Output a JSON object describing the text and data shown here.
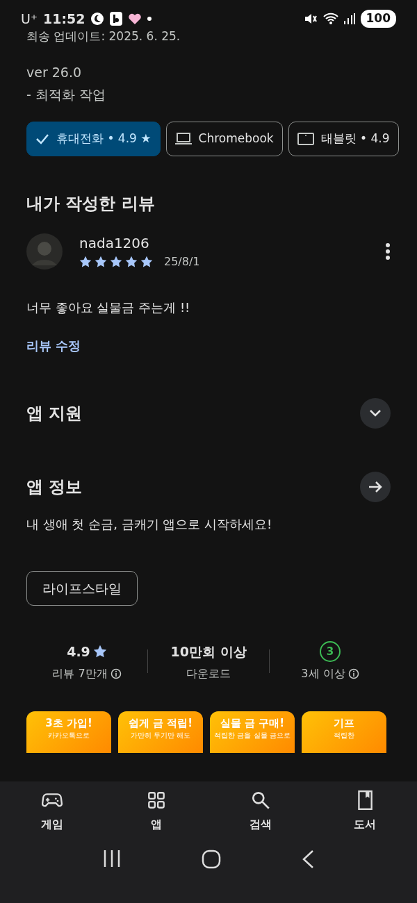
{
  "status_bar": {
    "carrier": "U⁺",
    "time": "11:52",
    "battery": "100"
  },
  "update": {
    "date_line": "최송 업데이트: 2025. 6. 25.",
    "version": "ver 26.0",
    "note": "- 최적화 작업"
  },
  "device_chips": [
    {
      "label": "휴대전화 • 4.9 ★",
      "selected": true
    },
    {
      "kind": "laptop",
      "label": "Chromebook",
      "selected": false
    },
    {
      "kind": "tablet",
      "label": "태블릿 • 4.9",
      "selected": false
    }
  ],
  "my_review": {
    "heading": "내가 작성한 리뷰",
    "user": "nada1206",
    "stars": 5,
    "date": "25/8/1",
    "text": "너무 좋아요 실물금 주는게 !!",
    "edit_link": "리뷰 수정"
  },
  "app_support": {
    "heading": "앱 지원",
    "expanded": false
  },
  "app_info": {
    "heading": "앱 정보",
    "description": "내 생애 첫 순금, 금캐기 앱으로 시작하세요!",
    "category": "라이프스타일"
  },
  "stats": [
    {
      "kind": "rating",
      "value": "4.9",
      "label": "리뷰 7만개"
    },
    {
      "kind": "downloads",
      "value": "10만회 이상",
      "label": "다운로드"
    },
    {
      "kind": "age",
      "value": "3",
      "label": "3세 이상"
    }
  ],
  "screenshots": [
    {
      "title": "3초 가입!",
      "subtitle": "카카오톡으로"
    },
    {
      "title": "쉽게 금 적립!",
      "subtitle": "가만히 두기만 해도"
    },
    {
      "title": "실물 금 구매!",
      "subtitle": "적립한 금을 실물 금으로"
    },
    {
      "title": "기프",
      "subtitle": "적립한"
    }
  ],
  "bottom_nav": [
    {
      "kind": "games",
      "label": "게임"
    },
    {
      "kind": "apps",
      "label": "앱"
    },
    {
      "kind": "search",
      "label": "검색"
    },
    {
      "kind": "books",
      "label": "도서"
    }
  ]
}
